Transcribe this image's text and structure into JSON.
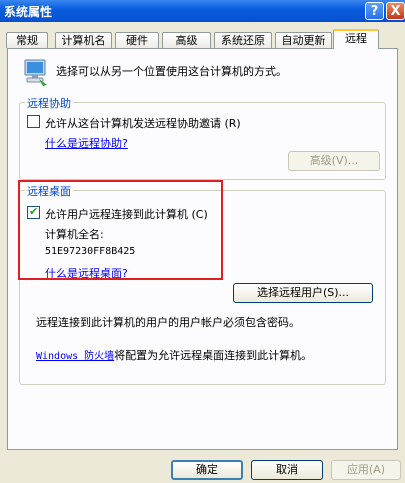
{
  "window": {
    "title": "系统属性"
  },
  "titlebar_buttons": {
    "help": "?",
    "close": "X"
  },
  "tabs": [
    {
      "label": "常规"
    },
    {
      "label": "计算机名"
    },
    {
      "label": "硬件"
    },
    {
      "label": "高级"
    },
    {
      "label": "系统还原"
    },
    {
      "label": "自动更新"
    },
    {
      "label": "远程",
      "active": true
    }
  ],
  "intro": {
    "text": "选择可以从另一个位置使用这台计算机的方式。",
    "icon": "computer-icon"
  },
  "remote_assistance": {
    "legend": "远程协助",
    "checkbox_label": "允许从这台计算机发送远程协助邀请 (R)",
    "checked": false,
    "link": "什么是远程协助?",
    "advanced_button": "高级(V)..."
  },
  "remote_desktop": {
    "legend": "远程桌面",
    "checkbox_label": "允许用户远程连接到此计算机 (C)",
    "checked": true,
    "computer_name_label": "计算机全名:",
    "computer_name_value": "51E97230FF8B425",
    "link": "什么是远程桌面?",
    "select_users_button": "选择远程用户(S)...",
    "password_note": "远程连接到此计算机的用户的用户帐户必须包含密码。",
    "firewall_link": "Windows 防火墙",
    "firewall_note": "将配置为允许远程桌面连接到此计算机。"
  },
  "footer": {
    "ok": "确定",
    "cancel": "取消",
    "apply": "应用(A)"
  },
  "colors": {
    "legend": "#0046d5",
    "link": "#0000ff",
    "highlight_box": "#e02020",
    "titlebar": "#0a5ee0"
  }
}
